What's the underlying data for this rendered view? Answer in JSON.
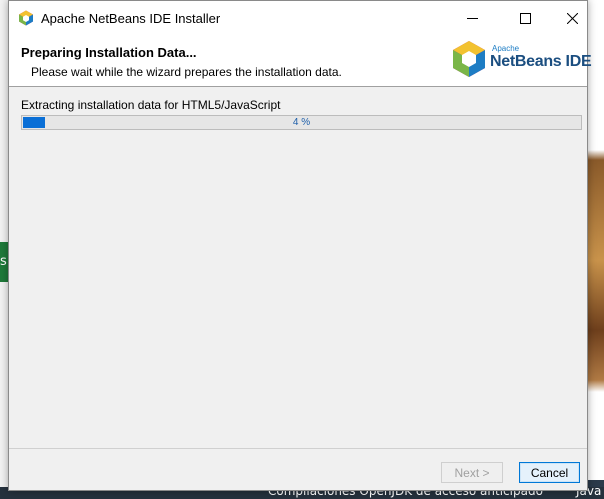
{
  "window": {
    "title": "Apache NetBeans IDE Installer"
  },
  "header": {
    "title": "Preparing Installation Data...",
    "description": "Please wait while the wizard prepares the installation data.",
    "logo_apache": "Apache",
    "logo_name": "NetBeans IDE"
  },
  "progress": {
    "status": "Extracting installation data for HTML5/JavaScript",
    "percent_label": "4 %",
    "fraction": 0.04
  },
  "buttons": {
    "next": "Next >",
    "cancel": "Cancel"
  },
  "background": {
    "bottom_text": "Compilaciones OpenJDK de acceso anticipado",
    "bottom_text_right": "Java",
    "green_fragment": "s"
  },
  "colors": {
    "progress_fill": "#0a6fd6",
    "accent_border": "#0078d7"
  }
}
